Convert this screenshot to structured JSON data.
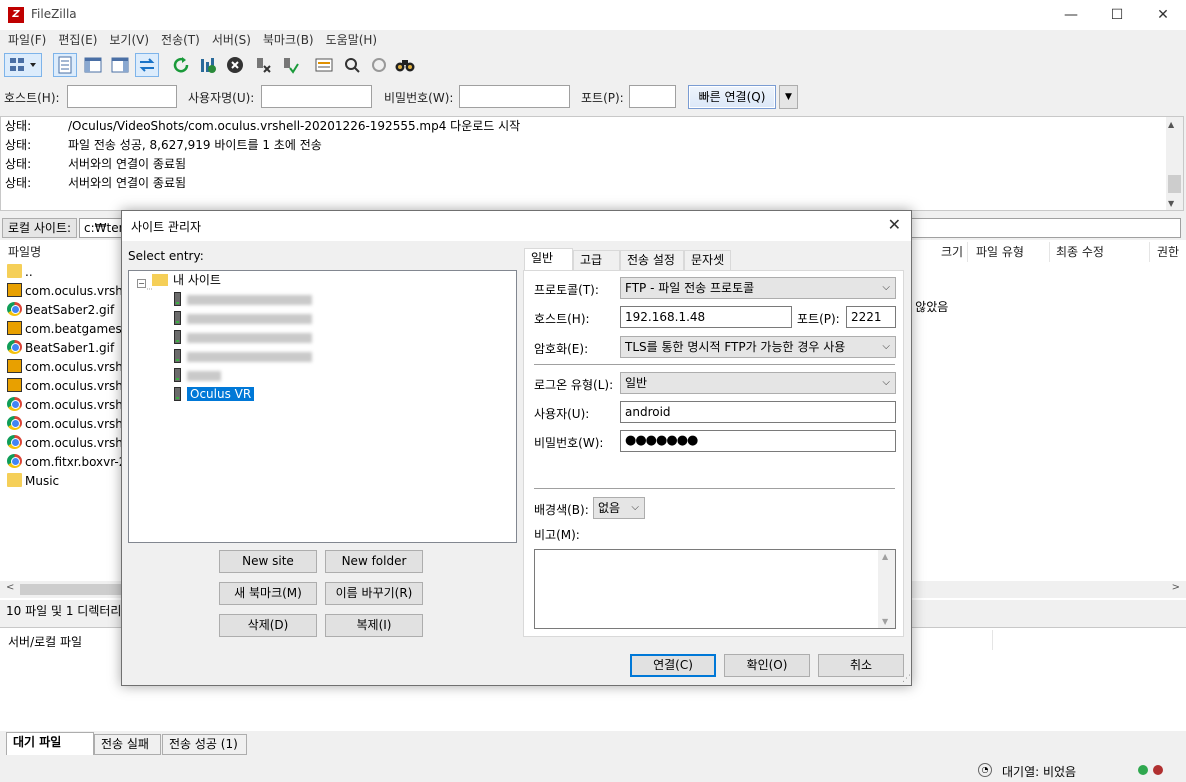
{
  "app": {
    "title": "FileZilla",
    "icon": "Z"
  },
  "window_controls": {
    "minimize": "—",
    "maximize": "☐",
    "close": "✕"
  },
  "menu": [
    "파일(F)",
    "편집(E)",
    "보기(V)",
    "전송(T)",
    "서버(S)",
    "북마크(B)",
    "도움말(H)"
  ],
  "toolbar": {
    "site_manager_icon": "site-manager-icon",
    "refresh_icon": "refresh-icon",
    "cancel_icon": "cancel-icon",
    "find_icon": "binoculars-icon"
  },
  "quickconnect": {
    "host_label": "호스트(H):",
    "user_label": "사용자명(U):",
    "pass_label": "비밀번호(W):",
    "port_label": "포트(P):",
    "connect_label": "빠른 연결(Q)",
    "host_value": "",
    "user_value": "",
    "pass_value": "",
    "port_value": ""
  },
  "log": [
    {
      "label": "상태:",
      "text": "/Oculus/VideoShots/com.oculus.vrshell-20201226-192555.mp4 다운로드 시작"
    },
    {
      "label": "상태:",
      "text": "파일 전송 성공, 8,627,919 바이트를 1 초에 전송"
    },
    {
      "label": "상태:",
      "text": "서버와의 연결이 종료됨"
    },
    {
      "label": "상태:",
      "text": "서버와의 연결이 종료됨"
    }
  ],
  "local": {
    "label": "로컬 사이트:",
    "path": "c:₩tem",
    "columns": {
      "name": "파일명",
      "size": "크기",
      "type": "파일 유형",
      "modified": "최종 수정",
      "perm": "권한"
    },
    "files": [
      {
        "name": "..",
        "icon": "folder"
      },
      {
        "name": "com.oculus.vrshel",
        "icon": "mp4"
      },
      {
        "name": "BeatSaber2.gif",
        "icon": "chrome"
      },
      {
        "name": "com.beatgames.b",
        "icon": "mp4"
      },
      {
        "name": "BeatSaber1.gif",
        "icon": "chrome"
      },
      {
        "name": "com.oculus.vrshel",
        "icon": "mp4"
      },
      {
        "name": "com.oculus.vrshel",
        "icon": "mp4"
      },
      {
        "name": "com.oculus.vrshel",
        "icon": "chrome"
      },
      {
        "name": "com.oculus.vrshel",
        "icon": "chrome"
      },
      {
        "name": "com.oculus.vrshel",
        "icon": "chrome"
      },
      {
        "name": "com.fitxr.boxvr-20",
        "icon": "chrome"
      },
      {
        "name": "Music",
        "icon": "folder"
      }
    ],
    "remote_note": "l 않았음",
    "summary": "10 파일 및 1 디렉터리"
  },
  "queue": {
    "column": "서버/로컬 파일",
    "tabs": [
      "대기 파일",
      "전송 실패",
      "전송 성공 (1)"
    ],
    "status": "대기열: 비었음"
  },
  "dialog": {
    "title": "사이트 관리자",
    "select_entry": "Select entry:",
    "tree_root": "내 사이트",
    "selected_site": "Oculus VR",
    "buttons": {
      "new_site": "New site",
      "new_folder": "New folder",
      "new_bookmark": "새 북마크(M)",
      "rename": "이름 바꾸기(R)",
      "delete": "삭제(D)",
      "duplicate": "복제(I)"
    },
    "tabs": [
      "일반",
      "고급",
      "전송 설정",
      "문자셋"
    ],
    "general": {
      "protocol_label": "프로토콜(T):",
      "protocol_value": "FTP - 파일 전송 프로토콜",
      "host_label": "호스트(H):",
      "host_value": "192.168.1.48",
      "port_label": "포트(P):",
      "port_value": "2221",
      "encryption_label": "암호화(E):",
      "encryption_value": "TLS를 통한 명시적 FTP가 가능한 경우 사용",
      "logon_label": "로그온 유형(L):",
      "logon_value": "일반",
      "user_label": "사용자(U):",
      "user_value": "android",
      "password_label": "비밀번호(W):",
      "password_value": "●●●●●●●",
      "bg_label": "배경색(B):",
      "bg_value": "없음",
      "comment_label": "비고(M):"
    },
    "footer": {
      "connect": "연결(C)",
      "ok": "확인(O)",
      "cancel": "취소"
    }
  }
}
